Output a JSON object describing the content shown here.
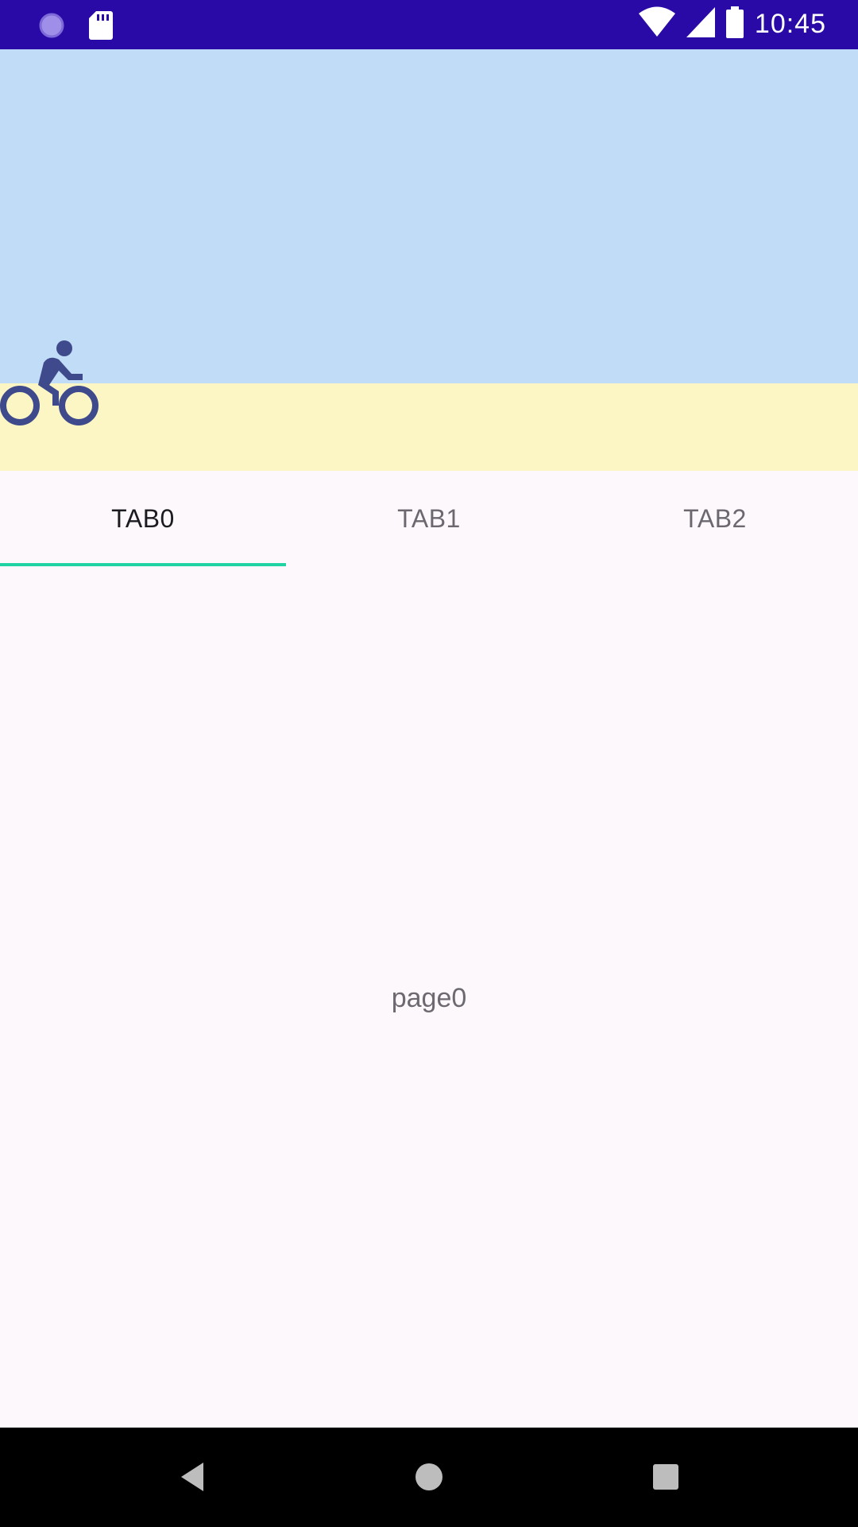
{
  "status_bar": {
    "time": "10:45",
    "icons": [
      "notification-circle-icon",
      "sd-card-icon",
      "wifi-icon",
      "cell-signal-icon",
      "battery-icon"
    ]
  },
  "tabs": [
    {
      "label": "TAB0",
      "selected": true
    },
    {
      "label": "TAB1",
      "selected": false
    },
    {
      "label": "TAB2",
      "selected": false
    }
  ],
  "page": {
    "text": "page0"
  },
  "header": {
    "icon": "bike-icon"
  },
  "colors": {
    "status_bar": "#2a0aa6",
    "sky": "#c0dcf6",
    "sand": "#fbf6c4",
    "indicator": "#1fd3a3",
    "bike": "#3f4a8c"
  },
  "nav_bar": {
    "buttons": [
      "back-icon",
      "home-icon",
      "recents-icon"
    ]
  }
}
